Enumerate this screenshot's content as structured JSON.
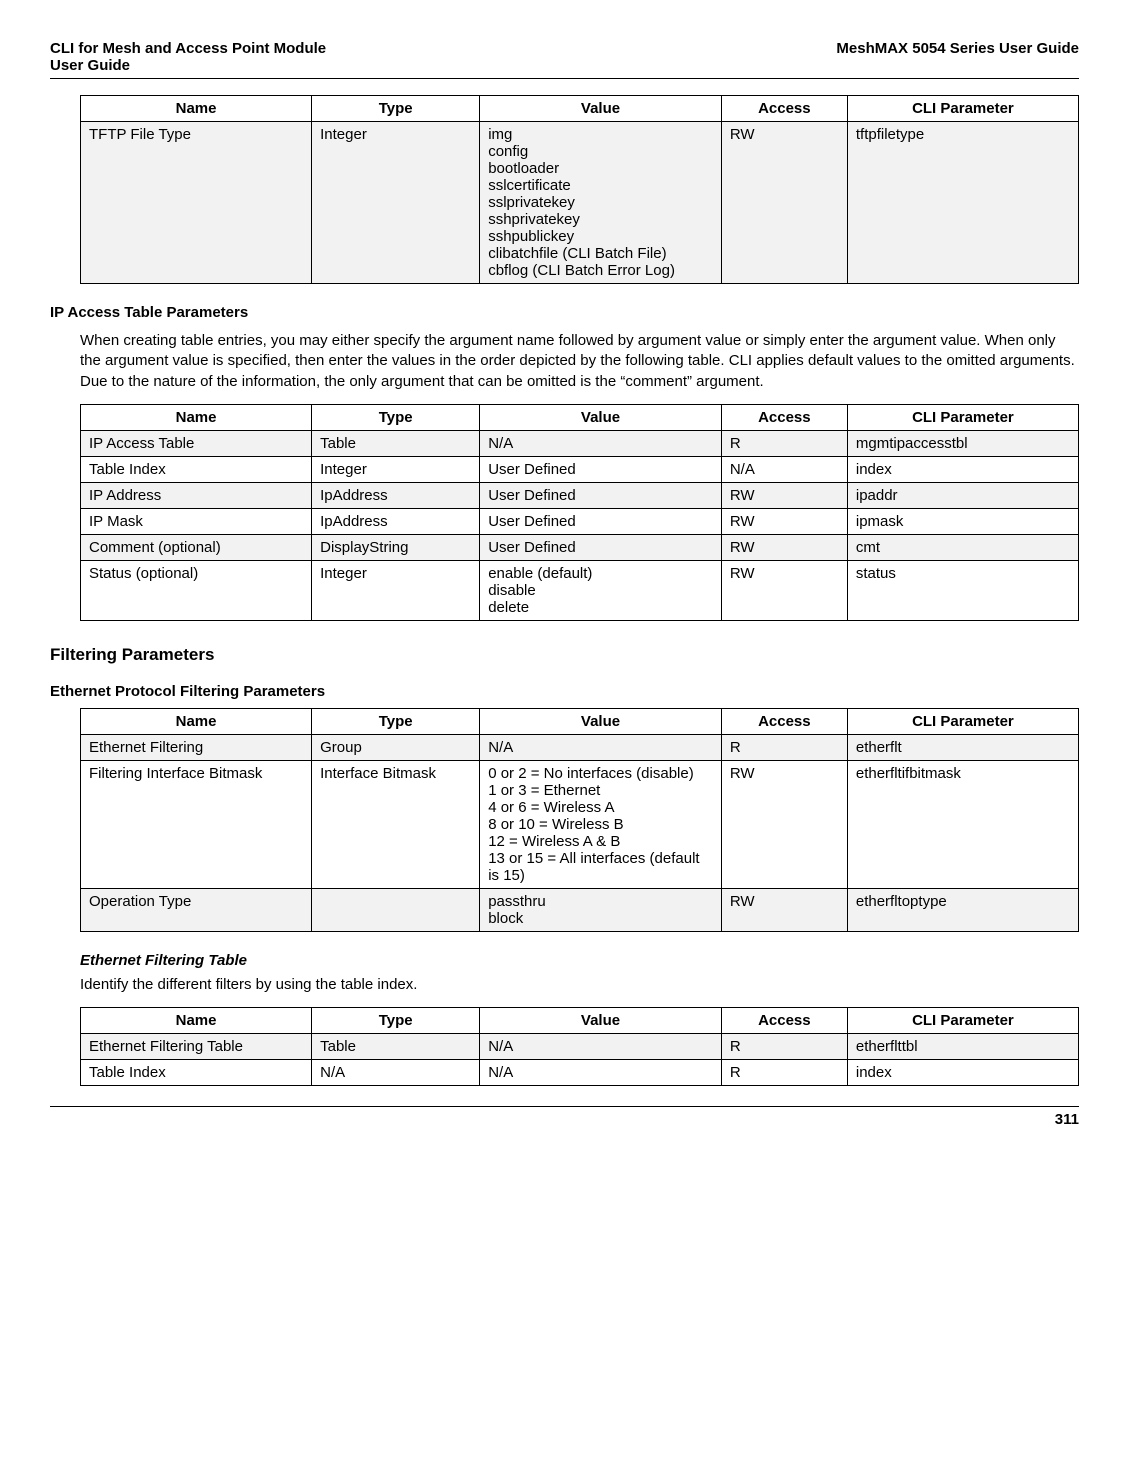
{
  "header": {
    "left_line1": "CLI for Mesh and Access Point Module",
    "left_line2": " User Guide",
    "right": "MeshMAX 5054 Series User Guide"
  },
  "table1": {
    "headers": [
      "Name",
      "Type",
      "Value",
      "Access",
      "CLI Parameter"
    ],
    "rows": [
      {
        "name": "TFTP File Type",
        "type": "Integer",
        "value": "img\nconfig\nbootloader\nsslcertificate\nsslprivatekey\nsshprivatekey\nsshpublickey\nclibatchfile (CLI Batch File)\ncbflog (CLI Batch Error Log)",
        "access": "RW",
        "cli": "tftpfiletype"
      }
    ]
  },
  "section_ip_access": {
    "heading": "IP Access Table Parameters",
    "paragraph": "When creating table entries, you may either specify the argument name followed by argument value or simply enter the argument value. When only the argument value is specified, then enter the values in the order depicted by the following table. CLI applies default values to the omitted arguments. Due to the nature of the information, the only argument that can be omitted is the “comment” argument."
  },
  "table2": {
    "headers": [
      "Name",
      "Type",
      "Value",
      "Access",
      "CLI Parameter"
    ],
    "rows": [
      {
        "name": "IP Access Table",
        "type": "Table",
        "value": "N/A",
        "access": "R",
        "cli": "mgmtipaccesstbl"
      },
      {
        "name": "Table Index",
        "type": "Integer",
        "value": "User Defined",
        "access": "N/A",
        "cli": "index"
      },
      {
        "name": "IP Address",
        "type": "IpAddress",
        "value": "User Defined",
        "access": "RW",
        "cli": "ipaddr"
      },
      {
        "name": "IP Mask",
        "type": "IpAddress",
        "value": "User Defined",
        "access": "RW",
        "cli": "ipmask"
      },
      {
        "name": "Comment (optional)",
        "type": "DisplayString",
        "value": "User Defined",
        "access": "RW",
        "cli": "cmt"
      },
      {
        "name": "Status (optional)",
        "type": "Integer",
        "value": "enable (default)\ndisable\ndelete",
        "access": "RW",
        "cli": "status"
      }
    ]
  },
  "section_filtering": {
    "heading": "Filtering Parameters"
  },
  "section_ethernet_protocol": {
    "heading": "Ethernet Protocol Filtering Parameters"
  },
  "table3": {
    "headers": [
      "Name",
      "Type",
      "Value",
      "Access",
      "CLI Parameter"
    ],
    "rows": [
      {
        "name": "Ethernet Filtering",
        "type": "Group",
        "value": "N/A",
        "access": "R",
        "cli": "etherflt"
      },
      {
        "name": "Filtering Interface Bitmask",
        "type": "Interface Bitmask",
        "value": "0 or 2 = No interfaces (disable)\n1 or 3 = Ethernet\n4 or 6 = Wireless A\n8 or 10 = Wireless B\n12 = Wireless A & B\n13 or 15 = All interfaces (default is 15)",
        "access": "RW",
        "cli": "etherfltifbitmask"
      },
      {
        "name": "Operation Type",
        "type": "",
        "value": "passthru\nblock",
        "access": "RW",
        "cli": "etherfltoptype"
      }
    ]
  },
  "section_eth_filter_table": {
    "heading": "Ethernet Filtering Table",
    "paragraph": "Identify the different filters by using the table index."
  },
  "table4": {
    "headers": [
      "Name",
      "Type",
      "Value",
      "Access",
      "CLI Parameter"
    ],
    "rows": [
      {
        "name": "Ethernet Filtering Table",
        "type": "Table",
        "value": "N/A",
        "access": "R",
        "cli": "etherflttbl"
      },
      {
        "name": "Table Index",
        "type": "N/A",
        "value": "N/A",
        "access": "R",
        "cli": "index"
      }
    ]
  },
  "footer": {
    "page": "311"
  }
}
